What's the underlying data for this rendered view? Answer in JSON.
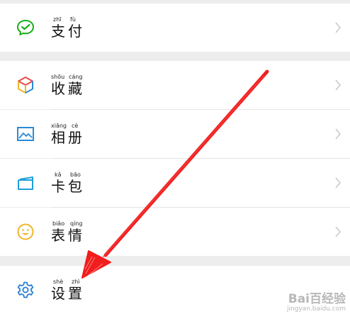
{
  "menu": {
    "pay": {
      "pinyin_1": "zhī",
      "pinyin_2": "fù",
      "label": "支付"
    },
    "collect": {
      "pinyin_1": "shōu",
      "pinyin_2": "cáng",
      "label": "收藏"
    },
    "album": {
      "pinyin_1": "xiāng",
      "pinyin_2": "cè",
      "label": "相册"
    },
    "cards": {
      "pinyin_1": "kǎ",
      "pinyin_2": "bāo",
      "label": "卡包"
    },
    "sticker": {
      "pinyin_1": "biǎo",
      "pinyin_2": "qíng",
      "label": "表情"
    },
    "settings": {
      "pinyin_1": "shè",
      "pinyin_2": "zhì",
      "label": "设置"
    }
  },
  "watermark": {
    "brand": "Bai百经验",
    "url": "jingyan.baidu.com"
  },
  "colors": {
    "page_bg": "#ededed",
    "pay_icon": "#1aad19",
    "album_icon": "#2a8ad6",
    "cards_icon": "#1f9fd8",
    "sticker_icon": "#f0b429",
    "settings_icon": "#2a7fd4",
    "arrow": "#f21d1d"
  },
  "icons": [
    "wechat-pay-icon",
    "favorites-cube-icon",
    "photo-album-icon",
    "card-wallet-icon",
    "smiley-icon",
    "gear-icon",
    "chevron-right-icon"
  ]
}
